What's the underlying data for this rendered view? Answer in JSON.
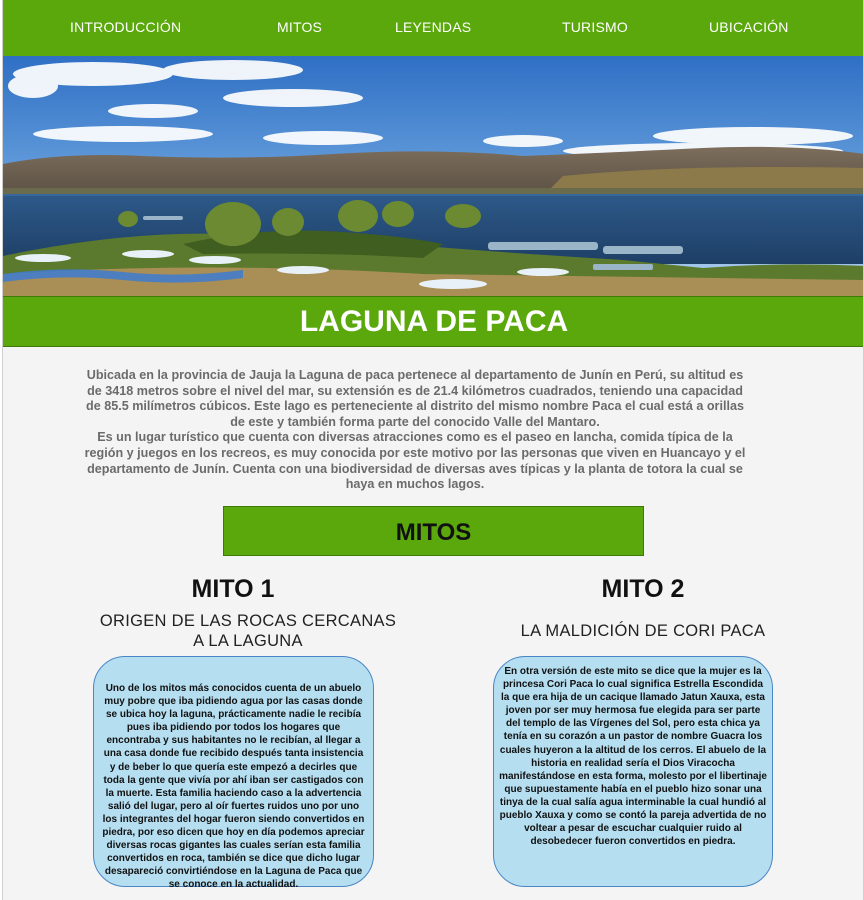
{
  "nav": {
    "items": [
      {
        "label": "INTRODUCCIÓN"
      },
      {
        "label": "MITOS"
      },
      {
        "label": "LEYENDAS"
      },
      {
        "label": "TURISMO"
      },
      {
        "label": "UBICACIÓN"
      }
    ]
  },
  "hero": {
    "icon": "lake-landscape-photo"
  },
  "page": {
    "title": "LAGUNA DE PACA"
  },
  "intro": {
    "paragraph_1": "Ubicada en la provincia de Jauja la Laguna de paca pertenece al departamento de Junín en Perú, su altitud es de 3418 metros sobre el nivel del mar, su extensión es de 21.4 kilómetros cuadrados, teniendo una capacidad de 85.5 milímetros cúbicos. Este lago es perteneciente al distrito del mismo nombre Paca el cual está a orillas de este y también forma parte del conocido Valle del Mantaro.",
    "paragraph_2": "Es un lugar turístico que cuenta con diversas atracciones como es el paseo en lancha, comida típica de la región y juegos en los recreos, es muy conocida por este motivo por las personas que viven en Huancayo y el departamento de Junín. Cuenta con una biodiversidad de diversas aves típicas y la planta de totora la cual se haya en muchos lagos."
  },
  "section": {
    "title": "MITOS"
  },
  "myths": [
    {
      "title": "MITO 1",
      "subtitle": "ORIGEN DE LAS ROCAS CERCANAS A LA LAGUNA",
      "text": "Uno de los mitos más conocidos cuenta de un abuelo muy pobre que iba pidiendo agua por las casas donde se ubica hoy la laguna, prácticamente nadie le recibía pues iba pidiendo por todos los hogares que encontraba y sus habitantes no le recibían, al llegar a una casa donde fue recibido después tanta insistencia y de beber lo que quería este empezó a decirles que toda la gente que vivía por ahí iban ser castigados con la muerte. Esta familia haciendo caso a la advertencia salió del lugar, pero al oír fuertes ruidos uno por uno los integrantes del hogar fueron siendo convertidos en piedra, por eso dicen que hoy en día podemos apreciar diversas rocas gigantes las cuales serían esta familia convertidos en roca, también se dice que dicho lugar desapareció convirtiéndose en la Laguna de Paca que se conoce en la actualidad."
    },
    {
      "title": "MITO 2",
      "subtitle": "LA MALDICIÓN DE CORI PACA",
      "text": "En otra versión de este mito se dice que la mujer es la princesa Cori Paca lo cual significa Estrella Escondida la que era hija de un cacique llamado Jatun Xauxa, esta joven por ser muy hermosa fue elegida para ser parte del templo de las Vírgenes del Sol, pero esta chica ya tenía en su corazón a un pastor de nombre Guacra los cuales huyeron a la altitud de los cerros. El abuelo de la historia en realidad sería el Dios Viracocha manifestándose en esta forma, molesto por el libertinaje que supuestamente había en el pueblo hizo sonar una tinya de la cual salía agua interminable la cual hundió al pueblo Xauxa y como se contó la pareja advertida de no voltear a pesar de escuchar cualquier ruido al desobedecer fueron convertidos en piedra."
    }
  ],
  "colors": {
    "nav_green": "#5aa80c",
    "bubble_blue": "#b5def0",
    "bubble_border": "#4a86c5",
    "page_bg": "#f4f4f4"
  }
}
